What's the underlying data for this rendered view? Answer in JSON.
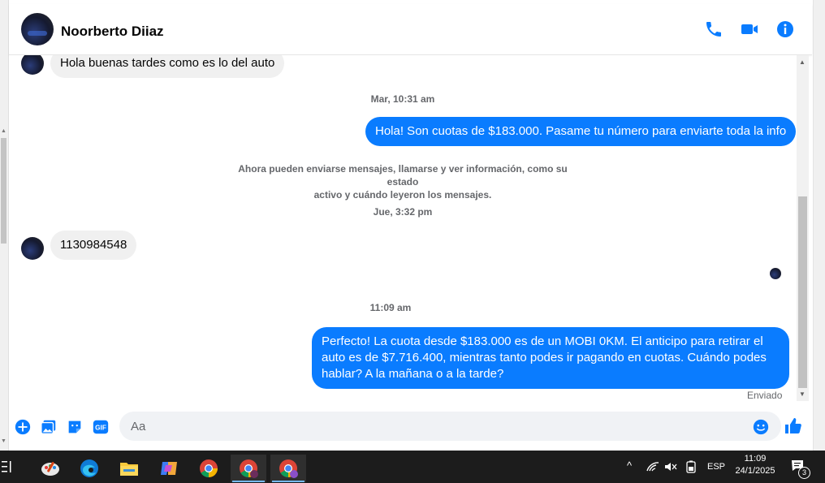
{
  "contact": {
    "name": "Noorberto Diiaz"
  },
  "messages": {
    "m1": "Hola buenas tardes como es lo del auto",
    "ts1": "Mar, 10:31 am",
    "m2": "Hola! Son cuotas de $183.000. Pasame tu número para enviarte toda la info",
    "sys1_line1": "Ahora pueden enviarse mensajes, llamarse y ver información, como su estado",
    "sys1_line2": "activo y cuándo leyeron los mensajes.",
    "ts2": "Jue, 3:32 pm",
    "m3": "1130984548",
    "ts3": "11:09 am",
    "m4": "Perfecto! La cuota desde $183.000 es de un MOBI 0KM. El anticipo para retirar el auto es de $7.716.400, mientras tanto podes ir pagando en cuotas. Cuándo podes hablar? A la mañana o a la tarde?",
    "status": "Enviado"
  },
  "composer": {
    "placeholder": "Aa"
  },
  "taskbar": {
    "language": "ESP",
    "time": "11:09",
    "date": "24/1/2025",
    "notifications": "3"
  },
  "colors": {
    "accent": "#0a7cff",
    "bubble_in": "#f0f0f0"
  }
}
